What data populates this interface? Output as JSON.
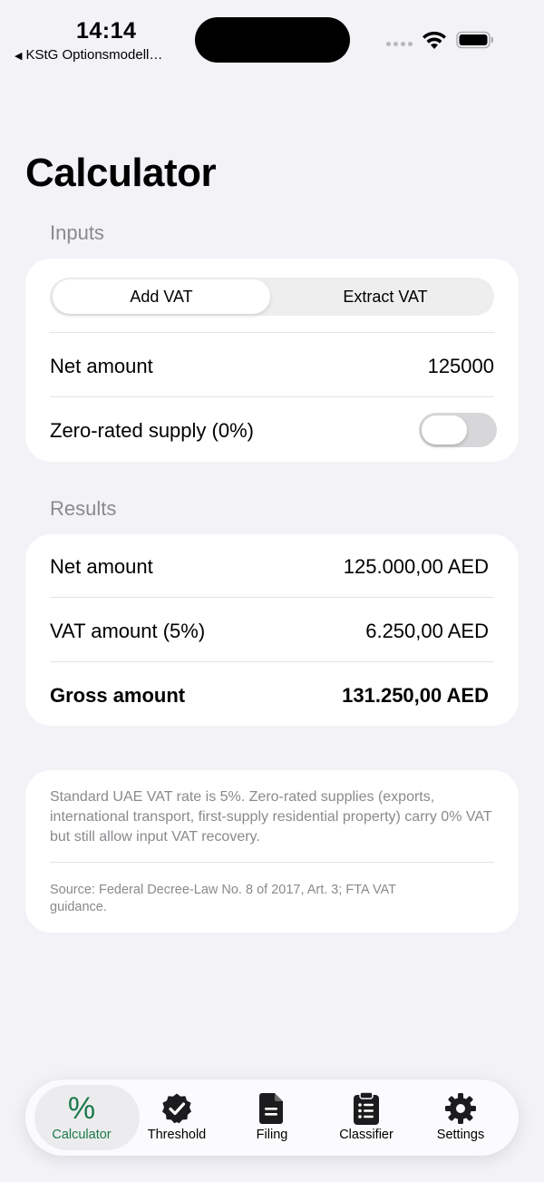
{
  "status_bar": {
    "time": "14:14",
    "back_app": "KStG Optionsmodell…"
  },
  "page": {
    "title": "Calculator"
  },
  "inputs": {
    "header": "Inputs",
    "mode_options": [
      "Add VAT",
      "Extract VAT"
    ],
    "selected_mode": "Add VAT",
    "net_amount_label": "Net amount",
    "net_amount_value": "125000",
    "zero_rated_label": "Zero-rated supply (0%)",
    "zero_rated_on": false
  },
  "results": {
    "header": "Results",
    "rows": [
      {
        "label": "Net amount",
        "value": "125.000,00 AED"
      },
      {
        "label": "VAT amount (5%)",
        "value": "6.250,00 AED"
      },
      {
        "label": "Gross amount",
        "value": "131.250,00 AED"
      }
    ]
  },
  "note": {
    "text": "Standard UAE VAT rate is 5%. Zero-rated supplies (exports, international transport, first-supply residential property) carry 0% VAT but still allow input VAT recovery.",
    "source": "Source: Federal Decree-Law No. 8 of 2017, Art. 3; FTA VAT guidance."
  },
  "tabbar": {
    "selected": "Calculator",
    "accent_color": "#1b7a4a",
    "tabs": [
      {
        "label": "Calculator",
        "icon": "percent-icon"
      },
      {
        "label": "Threshold",
        "icon": "checkmark-seal-icon"
      },
      {
        "label": "Filing",
        "icon": "document-icon"
      },
      {
        "label": "Classifier",
        "icon": "clipboard-list-icon"
      },
      {
        "label": "Settings",
        "icon": "gear-icon"
      }
    ]
  }
}
